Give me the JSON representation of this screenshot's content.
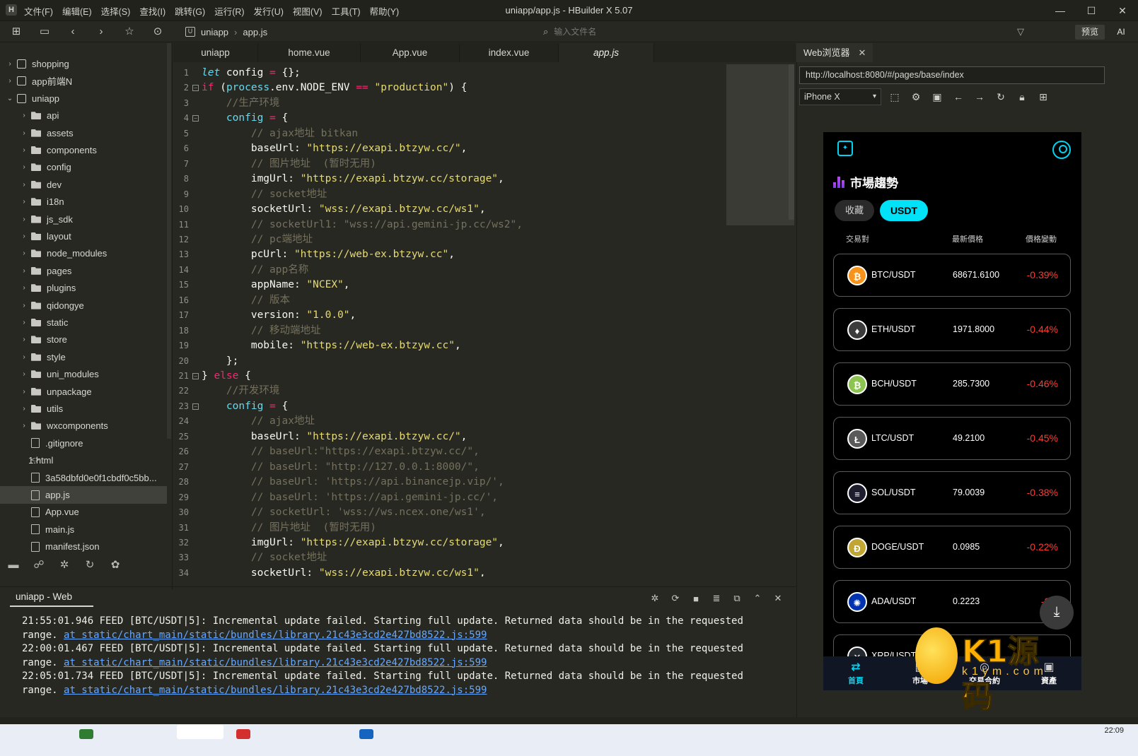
{
  "window": {
    "title": "uniapp/app.js - HBuilder X 5.07",
    "menu": [
      "文件(F)",
      "编辑(E)",
      "选择(S)",
      "查找(I)",
      "跳转(G)",
      "运行(R)",
      "发行(U)",
      "视图(V)",
      "工具(T)",
      "帮助(Y)"
    ],
    "controls": [
      "—",
      "☐",
      "✕"
    ]
  },
  "toolbar": {
    "breadcrumb": [
      "uniapp",
      "app.js"
    ],
    "file_search_placeholder": "输入文件名",
    "preview_label": "预览",
    "ai_label": "AI"
  },
  "sidebar": {
    "items": [
      {
        "label": "shopping",
        "type": "proj",
        "arrow": "›",
        "indent": 0
      },
      {
        "label": "app前端N",
        "type": "proj",
        "arrow": "›",
        "indent": 0
      },
      {
        "label": "uniapp",
        "type": "proj",
        "arrow": "⌄",
        "indent": 0
      },
      {
        "label": "api",
        "type": "folder",
        "arrow": "›",
        "indent": 1
      },
      {
        "label": "assets",
        "type": "folder",
        "arrow": "›",
        "indent": 1
      },
      {
        "label": "components",
        "type": "folder",
        "arrow": "›",
        "indent": 1
      },
      {
        "label": "config",
        "type": "folder",
        "arrow": "›",
        "indent": 1
      },
      {
        "label": "dev",
        "type": "folder",
        "arrow": "›",
        "indent": 1
      },
      {
        "label": "i18n",
        "type": "folder",
        "arrow": "›",
        "indent": 1
      },
      {
        "label": "js_sdk",
        "type": "folder",
        "arrow": "›",
        "indent": 1
      },
      {
        "label": "layout",
        "type": "folder",
        "arrow": "›",
        "indent": 1
      },
      {
        "label": "node_modules",
        "type": "folder",
        "arrow": "›",
        "indent": 1
      },
      {
        "label": "pages",
        "type": "folder",
        "arrow": "›",
        "indent": 1
      },
      {
        "label": "plugins",
        "type": "folder",
        "arrow": "›",
        "indent": 1
      },
      {
        "label": "qidongye",
        "type": "folder",
        "arrow": "›",
        "indent": 1
      },
      {
        "label": "static",
        "type": "folder",
        "arrow": "›",
        "indent": 1
      },
      {
        "label": "store",
        "type": "folder",
        "arrow": "›",
        "indent": 1
      },
      {
        "label": "style",
        "type": "folder",
        "arrow": "›",
        "indent": 1
      },
      {
        "label": "uni_modules",
        "type": "folder",
        "arrow": "›",
        "indent": 1
      },
      {
        "label": "unpackage",
        "type": "folder",
        "arrow": "›",
        "indent": 1
      },
      {
        "label": "utils",
        "type": "folder",
        "arrow": "›",
        "indent": 1
      },
      {
        "label": "wxcomponents",
        "type": "folder",
        "arrow": "›",
        "indent": 1
      },
      {
        "label": ".gitignore",
        "type": "file",
        "arrow": "",
        "indent": 1
      },
      {
        "label": "1.html",
        "type": "code",
        "arrow": "",
        "indent": 1
      },
      {
        "label": "3a58dbfd0e0f1cbdf0c5bb...",
        "type": "file",
        "arrow": "",
        "indent": 1
      },
      {
        "label": "app.js",
        "type": "file",
        "arrow": "",
        "indent": 1,
        "selected": true
      },
      {
        "label": "App.vue",
        "type": "file",
        "arrow": "",
        "indent": 1
      },
      {
        "label": "main.js",
        "type": "file",
        "arrow": "",
        "indent": 1
      },
      {
        "label": "manifest.json",
        "type": "file",
        "arrow": "",
        "indent": 1
      }
    ]
  },
  "tabs": [
    {
      "label": "uniapp",
      "active": false
    },
    {
      "label": "home.vue",
      "active": false
    },
    {
      "label": "App.vue",
      "active": false
    },
    {
      "label": "index.vue",
      "active": false
    },
    {
      "label": "app.js",
      "active": true
    }
  ],
  "editor": {
    "lines": [
      {
        "n": "1",
        "fold": false,
        "html": "<span class='i'>let</span> config <span class='k'>=</span> {};"
      },
      {
        "n": "2",
        "fold": true,
        "html": "<span class='k'>if</span> (<span class='v'>process</span>.env.NODE_ENV <span class='k'>==</span> <span class='s'>\"production\"</span>) {"
      },
      {
        "n": "3",
        "fold": false,
        "html": "    <span class='c'>//生产环境</span>"
      },
      {
        "n": "4",
        "fold": true,
        "html": "    <span class='v'>config</span> <span class='k'>=</span> {"
      },
      {
        "n": "5",
        "fold": false,
        "html": "        <span class='c'>// ajax地址 bitkan</span>"
      },
      {
        "n": "6",
        "fold": false,
        "html": "        baseUrl: <span class='s'>\"https://exapi.btzyw.cc/\"</span>,"
      },
      {
        "n": "7",
        "fold": false,
        "html": "        <span class='c'>// 图片地址  (暂时无用)</span>"
      },
      {
        "n": "8",
        "fold": false,
        "html": "        imgUrl: <span class='s'>\"https://exapi.btzyw.cc/storage\"</span>,"
      },
      {
        "n": "9",
        "fold": false,
        "html": "        <span class='c'>// socket地址</span>"
      },
      {
        "n": "10",
        "fold": false,
        "html": "        socketUrl: <span class='s'>\"wss://exapi.btzyw.cc/ws1\"</span>,"
      },
      {
        "n": "11",
        "fold": false,
        "html": "        <span class='c'>// socketUrl1: \"wss://api.gemini-jp.cc/ws2\",</span>"
      },
      {
        "n": "12",
        "fold": false,
        "html": "        <span class='c'>// pc端地址</span>"
      },
      {
        "n": "13",
        "fold": false,
        "html": "        pcUrl: <span class='s'>\"https://web-ex.btzyw.cc\"</span>,"
      },
      {
        "n": "14",
        "fold": false,
        "html": "        <span class='c'>// app名称</span>"
      },
      {
        "n": "15",
        "fold": false,
        "html": "        appName: <span class='s'>\"NCEX\"</span>,"
      },
      {
        "n": "16",
        "fold": false,
        "html": "        <span class='c'>// 版本</span>"
      },
      {
        "n": "17",
        "fold": false,
        "html": "        version: <span class='s'>\"1.0.0\"</span>,"
      },
      {
        "n": "18",
        "fold": false,
        "html": "        <span class='c'>// 移动端地址</span>"
      },
      {
        "n": "19",
        "fold": false,
        "html": "        mobile: <span class='s'>\"https://web-ex.btzyw.cc\"</span>,"
      },
      {
        "n": "20",
        "fold": false,
        "html": "    };"
      },
      {
        "n": "21",
        "fold": true,
        "html": "} <span class='k'>else</span> {"
      },
      {
        "n": "22",
        "fold": false,
        "html": "    <span class='c'>//开发环境</span>"
      },
      {
        "n": "23",
        "fold": true,
        "html": "    <span class='v'>config</span> <span class='k'>=</span> {"
      },
      {
        "n": "24",
        "fold": false,
        "html": "        <span class='c'>// ajax地址</span>"
      },
      {
        "n": "25",
        "fold": false,
        "html": "        baseUrl: <span class='s'>\"https://exapi.btzyw.cc/\"</span>,"
      },
      {
        "n": "26",
        "fold": false,
        "html": "        <span class='c'>// baseUrl:\"https://exapi.btzyw.cc/\",</span>"
      },
      {
        "n": "27",
        "fold": false,
        "html": "        <span class='c'>// baseUrl: \"http://127.0.0.1:8000/\",</span>"
      },
      {
        "n": "28",
        "fold": false,
        "html": "        <span class='c'>// baseUrl: 'https://api.binancejp.vip/',</span>"
      },
      {
        "n": "29",
        "fold": false,
        "html": "        <span class='c'>// baseUrl: 'https://api.gemini-jp.cc/',</span>"
      },
      {
        "n": "30",
        "fold": false,
        "html": "        <span class='c'>// socketUrl: 'wss://ws.ncex.one/ws1',</span>"
      },
      {
        "n": "31",
        "fold": false,
        "html": "        <span class='c'>// 图片地址  (暂时无用)</span>"
      },
      {
        "n": "32",
        "fold": false,
        "html": "        imgUrl: <span class='s'>\"https://exapi.btzyw.cc/storage\"</span>,"
      },
      {
        "n": "33",
        "fold": false,
        "html": "        <span class='c'>// socket地址</span>"
      },
      {
        "n": "34",
        "fold": false,
        "html": "        socketUrl: <span class='s'>\"wss://exapi.btzyw.cc/ws1\"</span>,"
      }
    ]
  },
  "console": {
    "tab_label": "uniapp - Web",
    "lines": [
      {
        "text": "21:55:01.946 FEED [BTC/USDT|5]: Incremental update failed. Starting full update. Returned data should be in the requested",
        "link": ""
      },
      {
        "text": "range. ",
        "link": "at static/chart_main/static/bundles/library.21c43e3cd2e427bd8522.js:599"
      },
      {
        "text": "22:00:01.467 FEED [BTC/USDT|5]: Incremental update failed. Starting full update. Returned data should be in the requested",
        "link": ""
      },
      {
        "text": "range. ",
        "link": "at static/chart_main/static/bundles/library.21c43e3cd2e427bd8522.js:599"
      },
      {
        "text": "22:05:01.734 FEED [BTC/USDT|5]: Incremental update failed. Starting full update. Returned data should be in the requested",
        "link": ""
      },
      {
        "text": "range. ",
        "link": "at static/chart_main/static/bundles/library.21c43e3cd2e427bd8522.js:599"
      }
    ]
  },
  "browser": {
    "tab_label": "Web浏览器",
    "url": "http://localhost:8080/#/pages/base/index",
    "device": "iPhone X"
  },
  "phone": {
    "title": "市場趨勢",
    "pill_fav": "收藏",
    "pill_usdt": "USDT",
    "col_pair": "交易對",
    "col_price": "最新價格",
    "col_change": "價格變動",
    "coins": [
      {
        "pair": "BTC/USDT",
        "price": "68671.6100",
        "change": "-0.39%",
        "glyph": "₿",
        "color": "#f7931a"
      },
      {
        "pair": "ETH/USDT",
        "price": "1971.8000",
        "change": "-0.44%",
        "glyph": "♦",
        "color": "#3c3c3d"
      },
      {
        "pair": "BCH/USDT",
        "price": "285.7300",
        "change": "-0.46%",
        "glyph": "₿",
        "color": "#8dc351"
      },
      {
        "pair": "LTC/USDT",
        "price": "49.2100",
        "change": "-0.45%",
        "glyph": "Ł",
        "color": "#5a5a5a"
      },
      {
        "pair": "SOL/USDT",
        "price": "79.0039",
        "change": "-0.38%",
        "glyph": "≡",
        "color": "#1d1d2e"
      },
      {
        "pair": "DOGE/USDT",
        "price": "0.0985",
        "change": "-0.22%",
        "glyph": "Ð",
        "color": "#c2a633"
      },
      {
        "pair": "ADA/USDT",
        "price": "0.2223",
        "change": "-0.4",
        "glyph": "✺",
        "color": "#0033ad"
      },
      {
        "pair": "XRP/USDT",
        "price": "",
        "change": "",
        "glyph": "✕",
        "color": "#23292f"
      }
    ],
    "nav": [
      "首頁",
      "市場",
      "交易合約",
      "資產"
    ]
  },
  "watermark": {
    "text": "K1源码",
    "sub": "k1ym.com"
  },
  "taskbar": {
    "time": "22:09"
  }
}
